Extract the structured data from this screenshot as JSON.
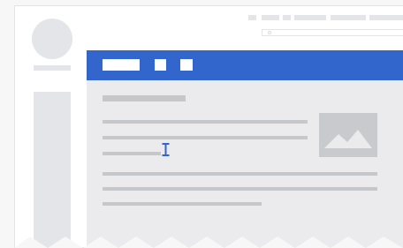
{
  "illustration": {
    "accent_color": "#3366cc",
    "image_icon": "image-placeholder-icon",
    "cursor_icon": "text-cursor-icon"
  }
}
